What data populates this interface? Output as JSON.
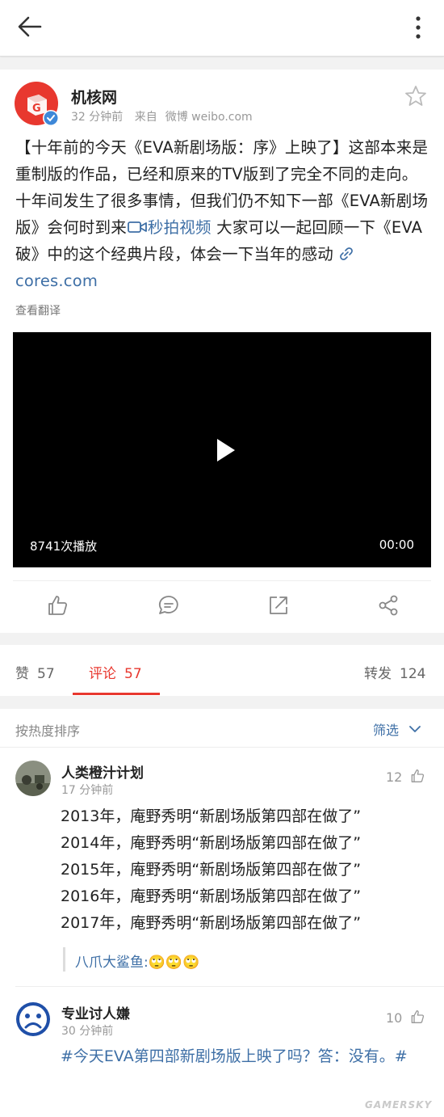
{
  "post": {
    "author": "机核网",
    "time": "32 分钟前",
    "source_prefix": "来自",
    "source": "微博 weibo.com",
    "text_main": "【十年前的今天《EVA新剧场版：序》上映了】这部本来是重制版的作品，已经和原来的TV版到了完全不同的走向。十年间发生了很多事情，但我们仍不知下一部《EVA新剧场版》会何时到来",
    "video_link": "秒拍视频",
    "text_after": " 大家可以一起回顾一下《EVA破》中的这个经典片段，体会一下当年的感动",
    "link": "cores.com",
    "translate": "查看翻译"
  },
  "video": {
    "play_count": "8741次播放",
    "duration": "00:00"
  },
  "tabs": {
    "likes_label": "赞",
    "likes_count": "57",
    "comments_label": "评论",
    "comments_count": "57",
    "reposts_label": "转发",
    "reposts_count": "124"
  },
  "sort": {
    "label": "按热度排序",
    "filter": "筛选"
  },
  "comments": [
    {
      "name": "人类橙汁计划",
      "time": "17 分钟前",
      "likes": "12",
      "lines": [
        "2013年，庵野秀明“新剧场版第四部在做了”",
        "2014年，庵野秀明“新剧场版第四部在做了”",
        "2015年，庵野秀明“新剧场版第四部在做了”",
        "2016年，庵野秀明“新剧场版第四部在做了”",
        "2017年，庵野秀明“新剧场版第四部在做了”"
      ],
      "reply": "八爪大鲨鱼:🙄🙄🙄"
    },
    {
      "name": "专业讨人嫌",
      "time": "30 分钟前",
      "likes": "10",
      "text": "#今天EVA第四部新剧场版上映了吗？答：没有。#"
    }
  ],
  "watermark": "GAMERSKY",
  "colors": {
    "accent_red": "#e8382f",
    "link_blue": "#3e6fa6"
  }
}
